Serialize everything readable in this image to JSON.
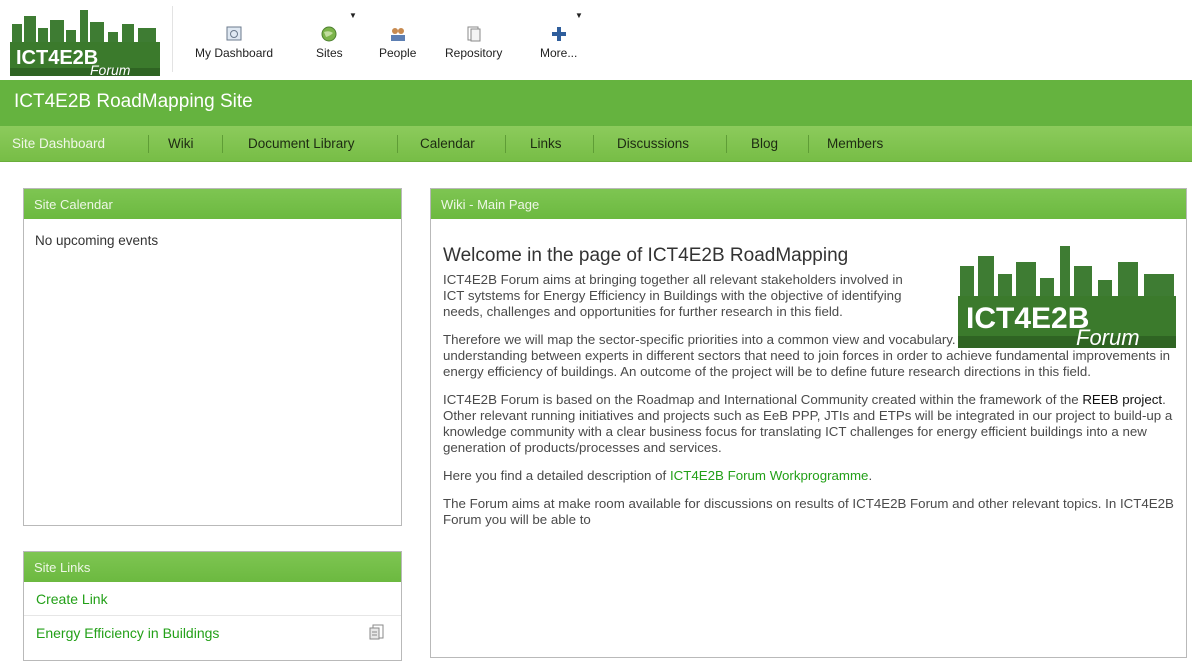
{
  "app": {
    "logo_text_main": "ICT4E2B",
    "logo_text_sub": "Forum"
  },
  "topnav": {
    "items": [
      {
        "label": "My Dashboard",
        "icon": "dashboard-icon"
      },
      {
        "label": "Sites",
        "icon": "globe-icon"
      },
      {
        "label": "People",
        "icon": "people-icon"
      },
      {
        "label": "Repository",
        "icon": "repository-icon"
      },
      {
        "label": "More...",
        "icon": "plus-icon"
      }
    ]
  },
  "site": {
    "title": "ICT4E2B RoadMapping Site"
  },
  "sitenav": {
    "items": [
      "Site Dashboard",
      "Wiki",
      "Document Library",
      "Calendar",
      "Links",
      "Discussions",
      "Blog",
      "Members"
    ],
    "active_index": 0
  },
  "calendar": {
    "title": "Site Calendar",
    "empty_text": "No upcoming events"
  },
  "links": {
    "title": "Site Links",
    "create_label": "Create Link",
    "items": [
      "Energy Efficiency in Buildings"
    ]
  },
  "wiki": {
    "title": "Wiki - Main Page",
    "heading": "Welcome in the page of ICT4E2B RoadMapping",
    "p1": "ICT4E2B Forum aims at bringing together all relevant stakeholders involved in ICT sytstems for Energy Efficiency in Buildings with the objective of identifying needs, challenges and opportunities for further research in this field.",
    "p2": "Therefore we will map the sector-specific priorities into a common view and vocabulary. This will enable communication and understanding between experts in different sectors that need to join forces in order to achieve fundamental improvements in energy efficiency of buildings. An outcome of the project will be to define future research directions in this field.",
    "p3_before": "ICT4E2B Forum is based on the Roadmap and International Community created within the framework of the ",
    "p3_link": "REEB project",
    "p3_after": ". Other relevant running initiatives and projects such as EeB PPP, JTIs and ETPs will be integrated in our project to build-up a knowledge community with a clear business focus for translating ICT challenges for energy efficient buildings into a new generation of products/processes and services.",
    "p4_before": "Here you find a detailed description of ",
    "p4_link": "ICT4E2B Forum Workprogramme",
    "p4_after": ".",
    "p5": "The Forum aims at make room available for discussions on results of ICT4E2B Forum and other relevant topics. In ICT4E2B Forum you will be able to"
  },
  "colors": {
    "brand_green": "#65b33f",
    "link_green": "#23a018"
  }
}
